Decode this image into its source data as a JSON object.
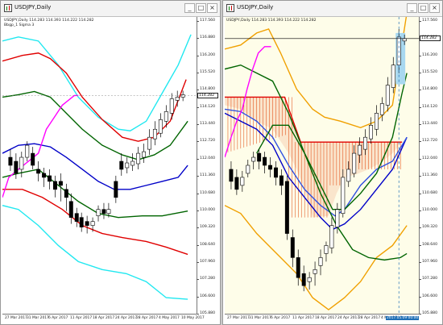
{
  "charts": [
    {
      "title": "USDJPY,Daily",
      "info_line1": "USDJPY,Daily  114.283 114.393 114.222 114.282",
      "info_line2": "Bbgp_1 Sigma 3",
      "price_tag": "114.282",
      "y_ticks": [
        "117.560",
        "116.880",
        "116.200",
        "115.520",
        "114.800",
        "114.120",
        "113.440",
        "112.720",
        "112.040",
        "111.360",
        "110.680",
        "110.000",
        "109.320",
        "108.640",
        "107.960",
        "107.280",
        "106.600",
        "105.880"
      ],
      "x_ticks": [
        "27 Mar 2017",
        "31 Mar 2017",
        "6 Apr 2017",
        "11 Apr 2017",
        "18 Apr 2017",
        "24 Apr 2017",
        "28 Apr 2017",
        "4 May 2017",
        "10 May 2017"
      ]
    },
    {
      "title": "USDJPY,Daily",
      "info_line1": "USDJPY,Daily  114.283 114.393 114.222 114.282",
      "price_tag": "114.282",
      "y_ticks": [
        "117.560",
        "116.880",
        "116.200",
        "115.520",
        "114.800",
        "114.120",
        "113.440",
        "112.720",
        "112.040",
        "111.360",
        "110.680",
        "110.000",
        "109.320",
        "108.640",
        "107.960",
        "107.280",
        "106.600",
        "105.880"
      ],
      "x_ticks": [
        "27 Mar 2017",
        "31 Mar 2017",
        "6 Apr 2017",
        "11 Apr 2017",
        "18 Apr 2017",
        "24 Apr 2017",
        "28 Apr 2017",
        "4 May 2017"
      ],
      "cursor_label": "2017.05.09 00:00"
    }
  ],
  "window_buttons": {
    "minimize": "_",
    "maximize": "□",
    "close": "×"
  },
  "colors": {
    "cyan_band": "#20e8f0",
    "red_band": "#e00000",
    "green_band": "#006400",
    "blue_mid": "#0000c8",
    "magenta_line": "#ff00ff",
    "orange_band": "#f0a000",
    "cloud_red": "#e03c00",
    "bull_candle": "#ffffff",
    "bear_candle": "#000000"
  }
}
